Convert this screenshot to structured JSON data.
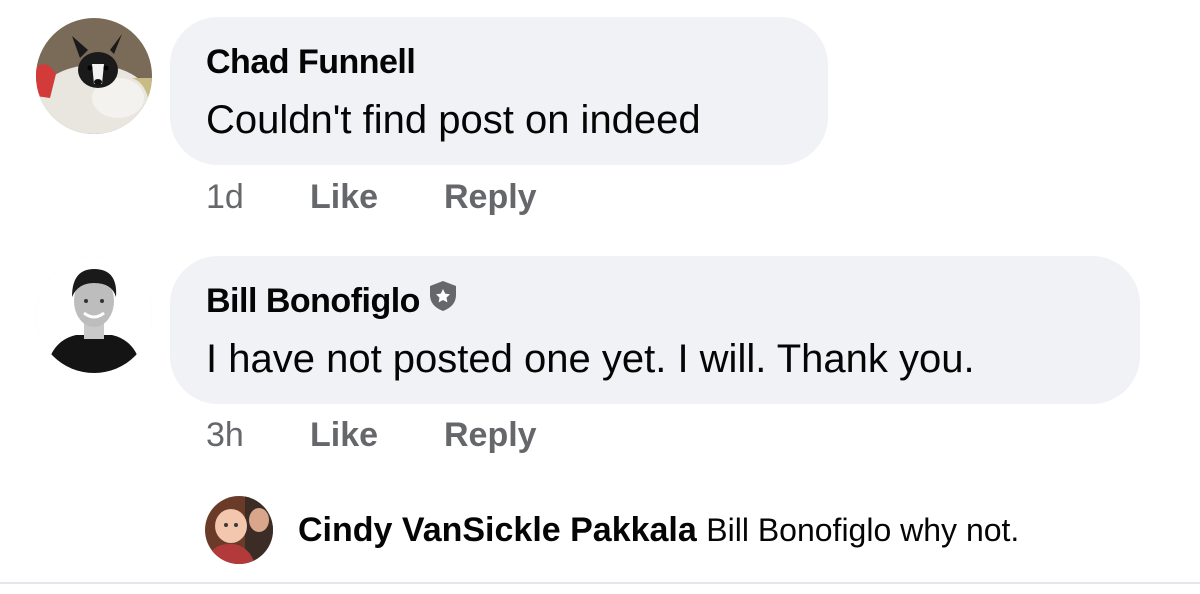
{
  "comments": [
    {
      "author": "Chad Funnell",
      "text": "Couldn't find post on indeed",
      "time": "1d",
      "like_label": "Like",
      "reply_label": "Reply",
      "avatar_icon": "dog-photo-avatar"
    },
    {
      "author": "Bill Bonofiglo",
      "text": "I have not posted one yet. I will. Thank you.",
      "time": "3h",
      "like_label": "Like",
      "reply_label": "Reply",
      "badge_icon": "admin-shield-icon",
      "avatar_icon": "person-photo-avatar"
    }
  ],
  "reply": {
    "author": "Cindy VanSickle Pakkala",
    "text": "Bill Bonofiglo why not.",
    "avatar_icon": "baby-photo-avatar"
  },
  "colors": {
    "bubble": "#f0f2f5",
    "text": "#050505",
    "meta": "#65676b"
  }
}
